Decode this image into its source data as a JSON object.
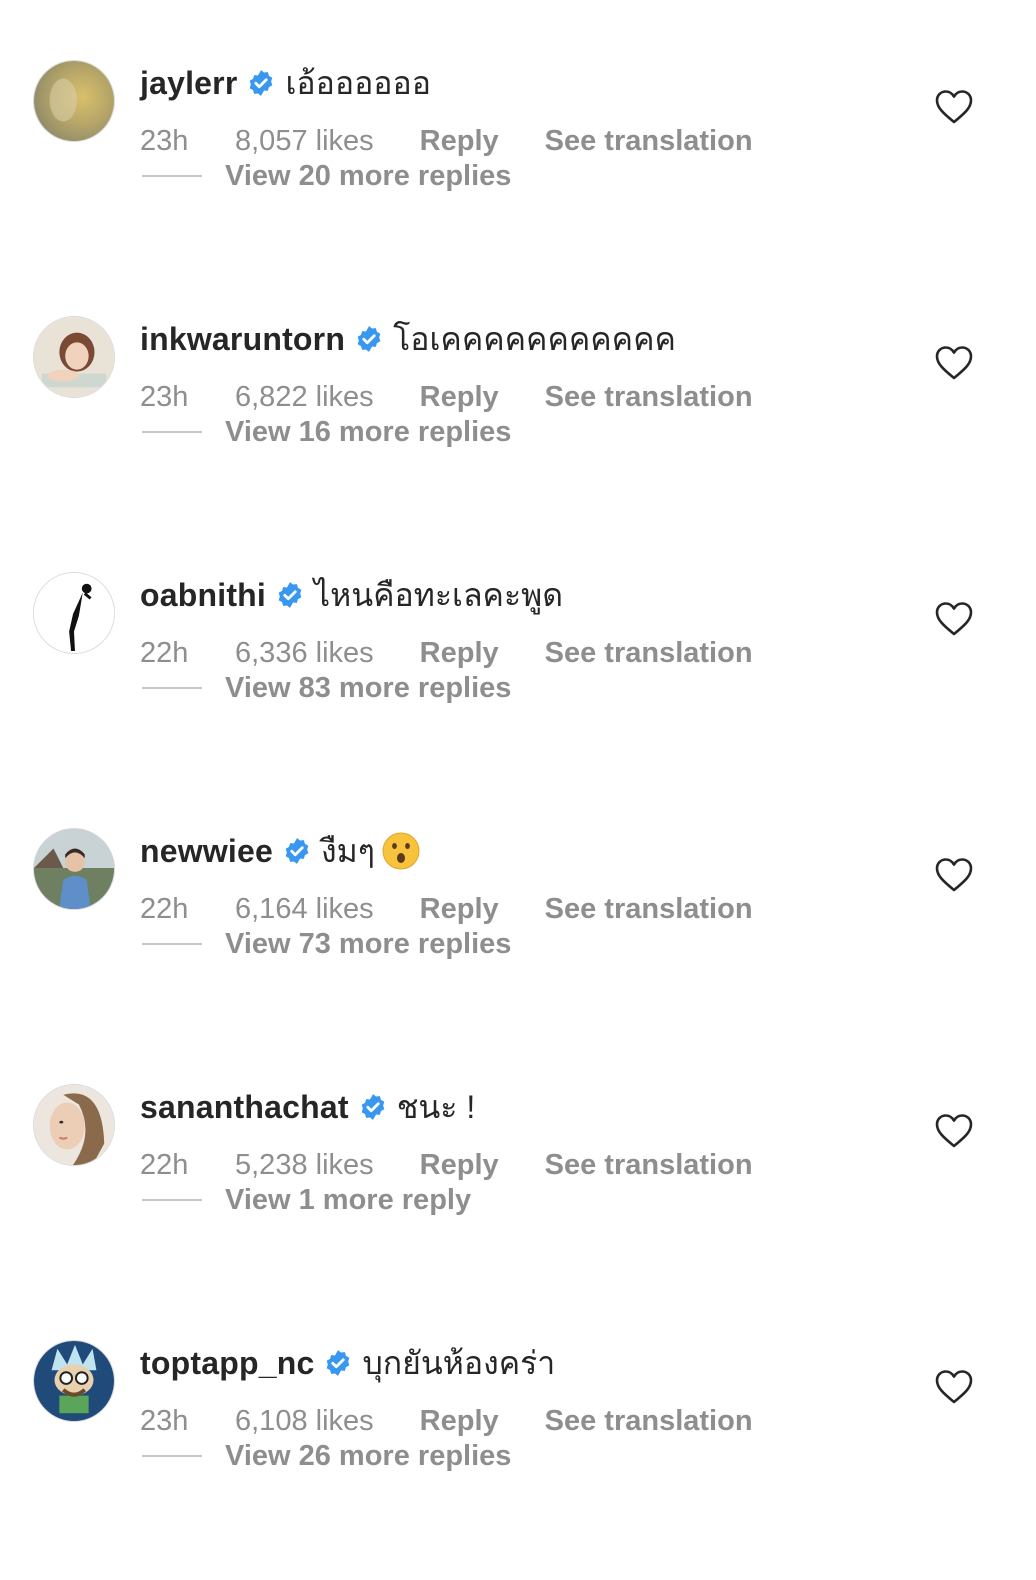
{
  "comments": [
    {
      "username": "jaylerr",
      "text": "เอ้ออออออ",
      "time": "23h",
      "likes": "8,057 likes",
      "reply_label": "Reply",
      "translation_label": "See translation",
      "more_replies": "View 20 more replies"
    },
    {
      "username": "inkwaruntorn",
      "text": "โอเคคคคคคคคคคค",
      "time": "23h",
      "likes": "6,822 likes",
      "reply_label": "Reply",
      "translation_label": "See translation",
      "more_replies": "View 16 more replies"
    },
    {
      "username": "oabnithi",
      "text": "ไหนคือทะเลคะพูด",
      "time": "22h",
      "likes": "6,336 likes",
      "reply_label": "Reply",
      "translation_label": "See translation",
      "more_replies": "View 83 more replies"
    },
    {
      "username": "newwiee",
      "text": "งืมๆ",
      "emoji": "hushed-face-emoji",
      "time": "22h",
      "likes": "6,164 likes",
      "reply_label": "Reply",
      "translation_label": "See translation",
      "more_replies": "View 73 more replies"
    },
    {
      "username": "sananthachat",
      "text": "ชนะ !",
      "time": "22h",
      "likes": "5,238 likes",
      "reply_label": "Reply",
      "translation_label": "See translation",
      "more_replies": "View 1 more reply"
    },
    {
      "username": "toptapp_nc",
      "text": "บุกยันห้องคร่า",
      "time": "23h",
      "likes": "6,108 likes",
      "reply_label": "Reply",
      "translation_label": "See translation",
      "more_replies": "View 26 more replies"
    }
  ],
  "icons": {
    "verified": "verified-badge-icon",
    "like": "heart-outline-icon"
  },
  "colors": {
    "verified_blue": "#3897f0",
    "primary_text": "#262626",
    "secondary_text": "#8e8e8e"
  }
}
